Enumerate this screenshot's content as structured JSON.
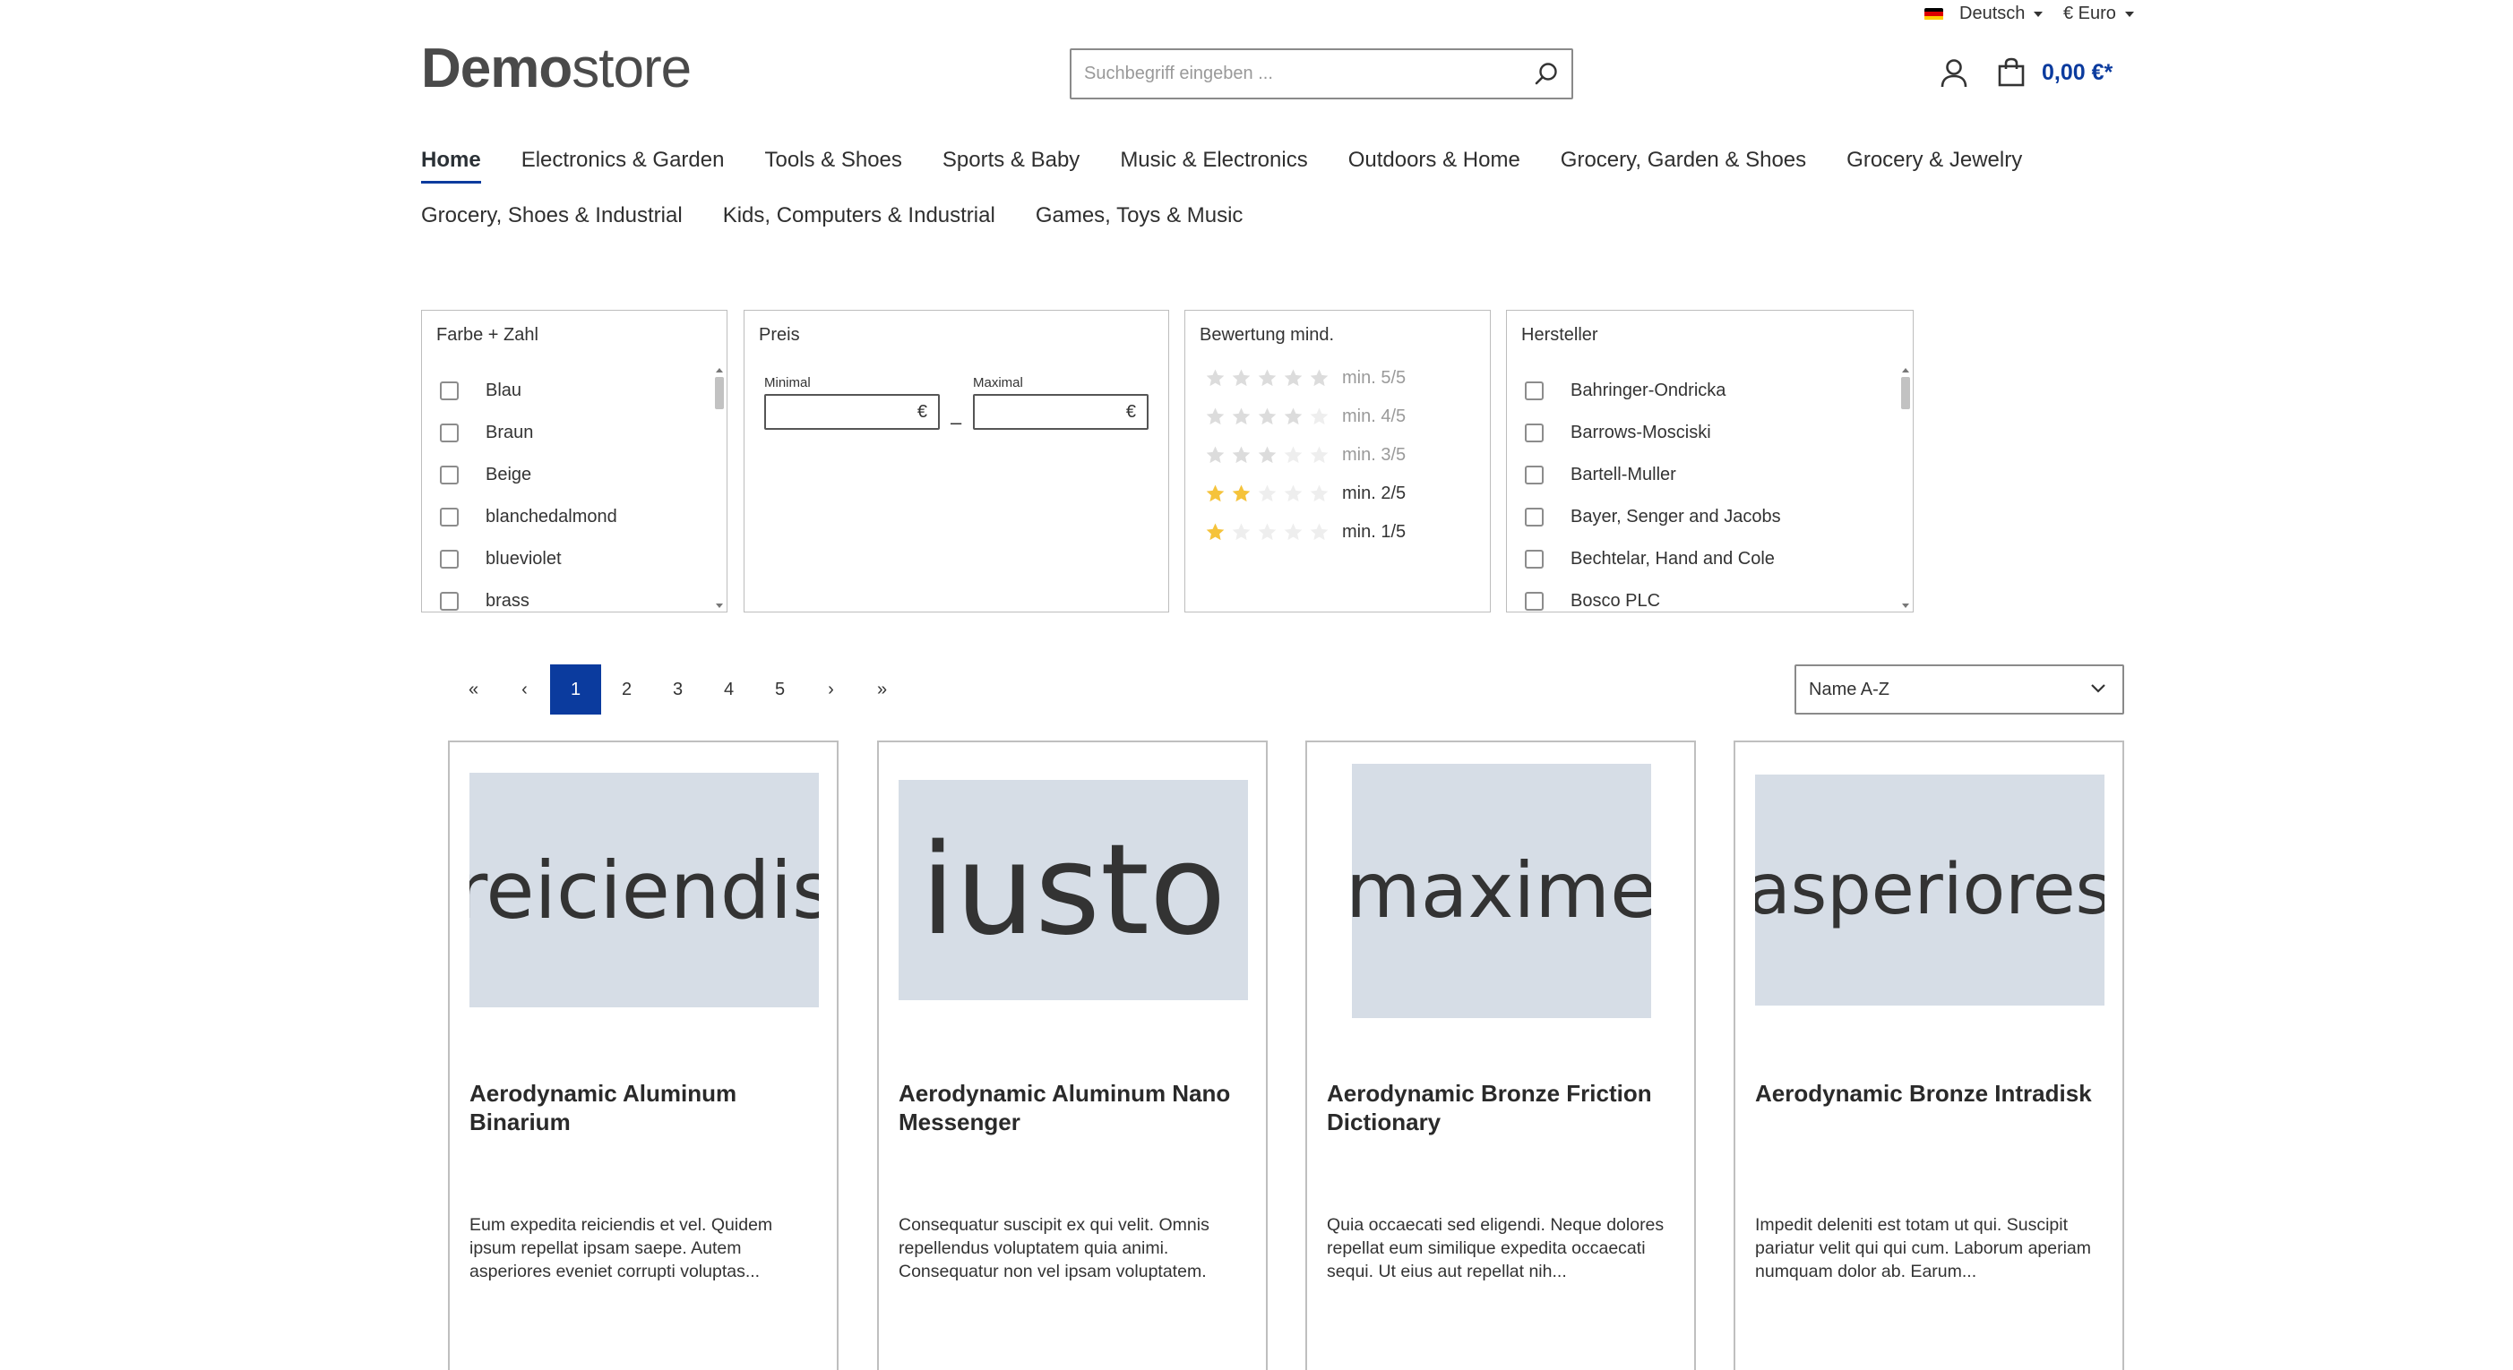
{
  "topbar": {
    "language": "Deutsch",
    "currency": "€ Euro",
    "flag_colors": [
      "#000000",
      "#dd0000",
      "#ffce00"
    ]
  },
  "header": {
    "logo_bold": "Demo",
    "logo_light": "store",
    "search_placeholder": "Suchbegriff eingeben ...",
    "cart_total": "0,00 €*"
  },
  "nav": {
    "row1": [
      "Home",
      "Electronics & Garden",
      "Tools & Shoes",
      "Sports & Baby",
      "Music & Electronics",
      "Outdoors & Home",
      "Grocery, Garden & Shoes",
      "Grocery & Jewelry"
    ],
    "row2": [
      "Grocery, Shoes & Industrial",
      "Kids, Computers & Industrial",
      "Games, Toys & Music"
    ]
  },
  "filters": {
    "color": {
      "title": "Farbe + Zahl",
      "items": [
        "Blau",
        "Braun",
        "Beige",
        "blanchedalmond",
        "blueviolet",
        "brass"
      ]
    },
    "price": {
      "title": "Preis",
      "min_label": "Minimal",
      "max_label": "Maximal",
      "currency_symbol": "€",
      "separator": "–"
    },
    "rating": {
      "title": "Bewertung mind.",
      "options": [
        {
          "label": "min. 5/5",
          "stars": 5,
          "enabled": false
        },
        {
          "label": "min. 4/5",
          "stars": 4,
          "enabled": false
        },
        {
          "label": "min. 3/5",
          "stars": 3,
          "enabled": false
        },
        {
          "label": "min. 2/5",
          "stars": 2,
          "enabled": true
        },
        {
          "label": "min. 1/5",
          "stars": 1,
          "enabled": true
        }
      ]
    },
    "manufacturer": {
      "title": "Hersteller",
      "items": [
        "Bahringer-Ondricka",
        "Barrows-Mosciski",
        "Bartell-Muller",
        "Bayer, Senger and Jacobs",
        "Bechtelar, Hand and Cole",
        "Bosco PLC"
      ]
    }
  },
  "pagination": {
    "first": "«",
    "prev": "‹",
    "pages": [
      "1",
      "2",
      "3",
      "4",
      "5"
    ],
    "current": "1",
    "next": "›",
    "last": "»"
  },
  "sort": {
    "selected": "Name A-Z"
  },
  "products": [
    {
      "image_text": "reiciendis",
      "name": "Aerodynamic Aluminum Binarium",
      "description": "Eum expedita reiciendis et vel. Quidem ipsum repellat ipsam saepe. Autem asperiores eveniet corrupti voluptas..."
    },
    {
      "image_text": "iusto",
      "name": "Aerodynamic Aluminum Nano Messenger",
      "description": "Consequatur suscipit ex qui velit. Omnis repellendus voluptatem quia animi. Consequatur non vel ipsam voluptatem."
    },
    {
      "image_text": "maxime",
      "name": "Aerodynamic Bronze Friction Dictionary",
      "description": "Quia occaecati sed eligendi. Neque dolores repellat eum similique expedita occaecati sequi. Ut eius aut repellat nih..."
    },
    {
      "image_text": "asperiores",
      "name": "Aerodynamic Bronze Intradisk",
      "description": "Impedit deleniti est totam ut qui. Suscipit pariatur velit qui qui cum. Laborum aperiam numquam dolor ab. Earum..."
    }
  ],
  "colors": {
    "accent": "#0b3b9e",
    "star_filled": "#f5c33b",
    "star_empty": "#e4e4e4",
    "placeholder_image": "#d6dde6"
  }
}
